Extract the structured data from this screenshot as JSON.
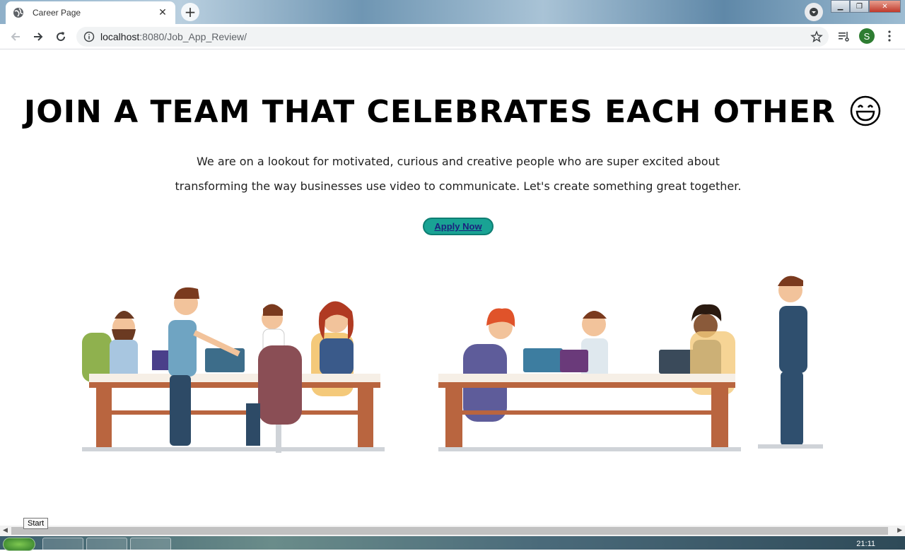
{
  "browser": {
    "tab_title": "Career Page",
    "tab_close": "✕",
    "new_tab": "+",
    "url_host": "localhost",
    "url_path": ":8080/Job_App_Review/",
    "profile_initial": "S",
    "icons": [
      "globe-icon",
      "back-icon",
      "forward-icon",
      "reload-icon",
      "info-icon",
      "star-icon",
      "reading-list-icon",
      "menu-icon"
    ]
  },
  "page": {
    "headline": "JOIN A TEAM THAT CELEBRATES EACH OTHER",
    "lead_line1": "We are on a lookout for motivated, curious and creative people who are super excited about",
    "lead_line2": "transforming the way businesses use video to communicate. Let's create something great together.",
    "apply_label": "Apply Now",
    "accent_color": "#19a394"
  },
  "taskbar": {
    "start_tooltip": "Start",
    "clock": "21:11"
  }
}
